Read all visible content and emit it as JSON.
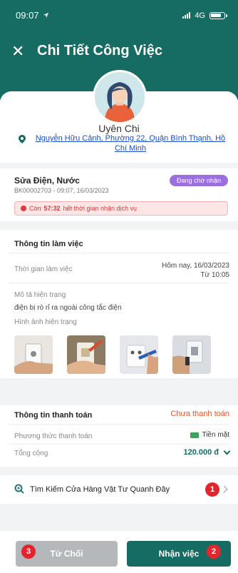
{
  "status_bar": {
    "time": "09:07",
    "network": "4G"
  },
  "header": {
    "title": "Chi Tiết Công Việc"
  },
  "customer": {
    "name": "Uyên Chi",
    "address_line1": "Nguyễn Hữu Cảnh, Phường 22, Quận Bình Thạnh, Hồ",
    "address_line2": "Chí Minh"
  },
  "service": {
    "name": "Sửa Điện, Nước",
    "code_time": "BK00002703 - 09:07, 16/03/2023",
    "status": "Đang chờ nhận",
    "timer_prefix": "Còn",
    "timer_value": "57:32",
    "timer_suffix": "hết thời gian nhận dịch vụ"
  },
  "work_info": {
    "title": "Thông tin làm việc",
    "time_label": "Thời gian làm việc",
    "time_value_line1": "Hôm nay, 16/03/2023",
    "time_value_line2": "Từ 10:05",
    "desc_label": "Mô tả hiện trạng",
    "desc_value": "điện bị rò rỉ ra ngoài công tắc điện",
    "images_label": "Hình ảnh hiện trạng"
  },
  "payment": {
    "title": "Thông tin thanh toán",
    "status": "Chưa thanh toán",
    "method_label": "Phương thức thanh toán",
    "method_value": "Tiền mặt",
    "total_label": "Tổng cộng",
    "total_value": "120.000 đ"
  },
  "search_store": {
    "label": "Tìm Kiếm Cửa Hàng Vật Tư Quanh Đây"
  },
  "badges": {
    "one": "1",
    "two": "2",
    "three": "3"
  },
  "actions": {
    "reject": "Từ Chối",
    "accept": "Nhận việc"
  },
  "colors": {
    "primary": "#166b62",
    "badge_purple": "#9b6fe0",
    "warning_red": "#e3262d",
    "unpaid_orange": "#e7562c"
  },
  "icons": [
    "close-icon",
    "location-pin-icon",
    "clock-alert-icon",
    "cash-icon",
    "chevron-down-icon",
    "search-icon",
    "chevron-right-icon"
  ]
}
